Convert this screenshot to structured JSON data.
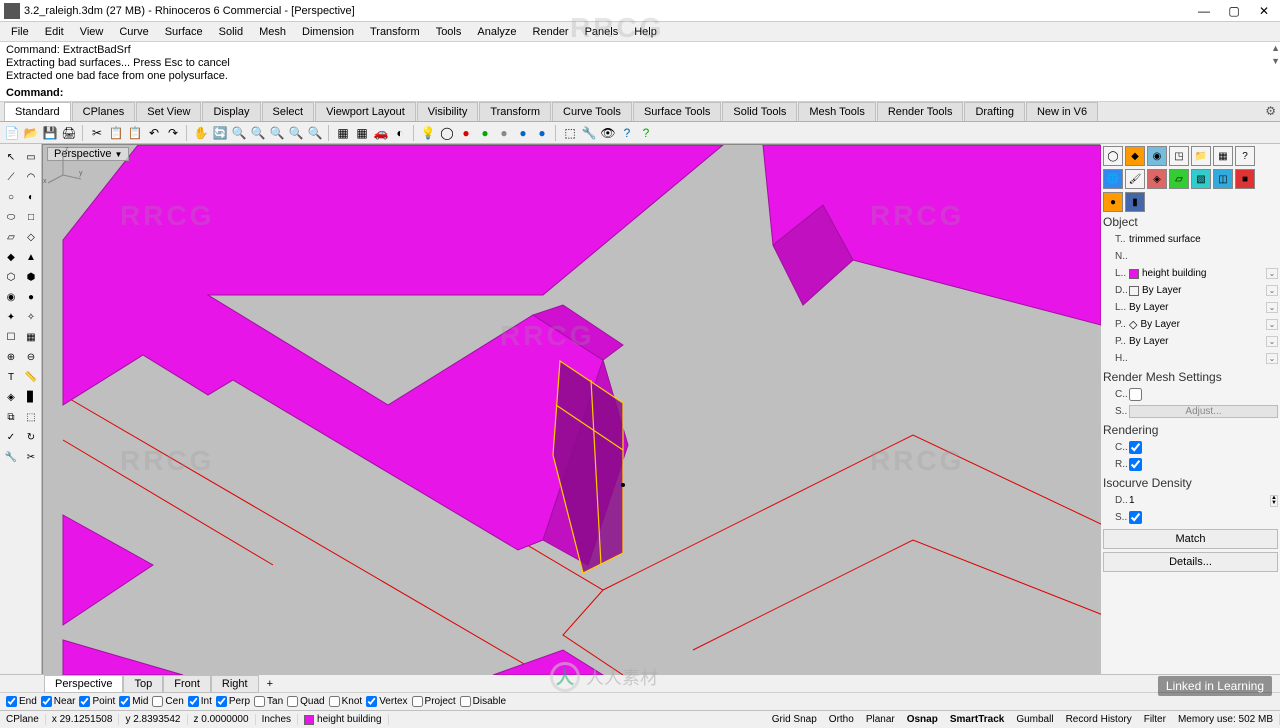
{
  "title": "3.2_raleigh.3dm (27 MB) - Rhinoceros 6 Commercial - [Perspective]",
  "menu": [
    "File",
    "Edit",
    "View",
    "Curve",
    "Surface",
    "Solid",
    "Mesh",
    "Dimension",
    "Transform",
    "Tools",
    "Analyze",
    "Render",
    "Panels",
    "Help"
  ],
  "cmd_history": [
    "Command: ExtractBadSrf",
    "Extracting bad surfaces... Press Esc to cancel",
    "Extracted one bad face from one polysurface."
  ],
  "cmd_prompt": "Command:",
  "tabs": [
    "Standard",
    "CPlanes",
    "Set View",
    "Display",
    "Select",
    "Viewport Layout",
    "Visibility",
    "Transform",
    "Curve Tools",
    "Surface Tools",
    "Solid Tools",
    "Mesh Tools",
    "Render Tools",
    "Drafting",
    "New in V6"
  ],
  "active_tab": 0,
  "viewport_label": "Perspective",
  "right": {
    "object_head": "Object",
    "type_lbl": "T..",
    "type_val": "trimmed surface",
    "name_lbl": "N..",
    "layer_lbl": "L..",
    "layer_val": "height building",
    "layer_color": "#e815e8",
    "disp_lbl": "D..",
    "disp_val": "By Layer",
    "ltype_lbl": "L..",
    "ltype_val": "By Layer",
    "print_lbl": "P..",
    "print_val": "By Layer",
    "pwidth_lbl": "P..",
    "pwidth_val": "By Layer",
    "h_lbl": "H..",
    "rms_head": "Render Mesh Settings",
    "rms_c_lbl": "C..",
    "rms_s_lbl": "S..",
    "rms_adjust": "Adjust...",
    "render_head": "Rendering",
    "ren_c_lbl": "C..",
    "ren_r_lbl": "R..",
    "iso_head": "Isocurve Density",
    "iso_d_lbl": "D..",
    "iso_d_val": "1",
    "iso_s_lbl": "S..",
    "match": "Match",
    "details": "Details..."
  },
  "vptabs": [
    "Perspective",
    "Top",
    "Front",
    "Right"
  ],
  "active_vptab": 0,
  "osnap": [
    {
      "label": "End",
      "checked": true
    },
    {
      "label": "Near",
      "checked": true
    },
    {
      "label": "Point",
      "checked": true
    },
    {
      "label": "Mid",
      "checked": true
    },
    {
      "label": "Cen",
      "checked": false
    },
    {
      "label": "Int",
      "checked": true
    },
    {
      "label": "Perp",
      "checked": true
    },
    {
      "label": "Tan",
      "checked": false
    },
    {
      "label": "Quad",
      "checked": false
    },
    {
      "label": "Knot",
      "checked": false
    },
    {
      "label": "Vertex",
      "checked": true
    },
    {
      "label": "Project",
      "checked": false
    },
    {
      "label": "Disable",
      "checked": false
    }
  ],
  "status": {
    "cplane": "CPlane",
    "x": "x 29.1251508",
    "y": "y 2.8393542",
    "z": "z 0.0000000",
    "units": "Inches",
    "layer": "height building",
    "toggles": [
      "Grid Snap",
      "Ortho",
      "Planar",
      "Osnap",
      "SmartTrack",
      "Gumball",
      "Record History",
      "Filter"
    ],
    "bold_toggles": [
      "Osnap",
      "SmartTrack"
    ],
    "mem": "Memory use: 502 MB"
  },
  "linkedin": "Linked in Learning"
}
